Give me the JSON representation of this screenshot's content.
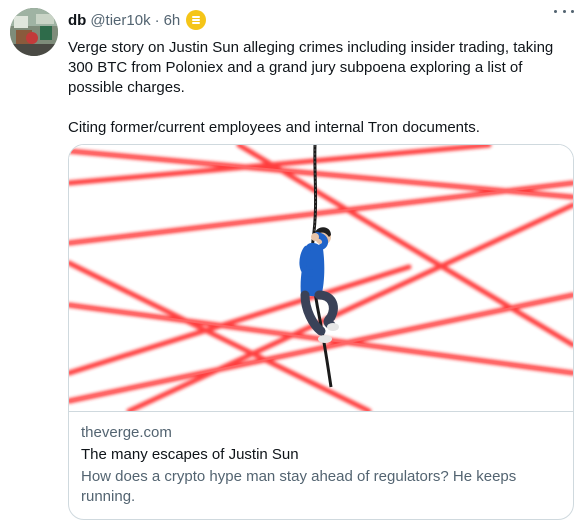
{
  "tweet": {
    "author": {
      "name": "db",
      "handle": "@tier10k",
      "time": "6h",
      "badge_color": "#f5c518"
    },
    "paragraphs": [
      "Verge story on Justin Sun alleging crimes including insider trading, taking 300 BTC from Poloniex and a grand jury subpoena exploring a list of possible charges.",
      "Citing former/current employees and internal Tron documents."
    ],
    "card": {
      "domain": "theverge.com",
      "title": "The many escapes of Justin Sun",
      "description": "How does a crypto hype man stay ahead of regulators? He keeps running.",
      "image_icon": "laser-grid-rope-climber-image"
    }
  },
  "colors": {
    "text": "#0f1419",
    "secondary": "#536471",
    "border": "#cfd9de",
    "laser": "#ff2a2a"
  }
}
